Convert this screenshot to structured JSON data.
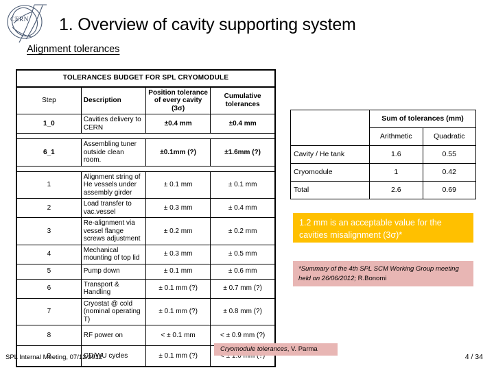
{
  "slide": {
    "title": "1. Overview of cavity supporting system",
    "subtitle": "Alignment tolerances",
    "logo_text": "CERN"
  },
  "main_table": {
    "title": "TOLERANCES BUDGET FOR SPL CRYOMODULE",
    "headers": {
      "step": "Step",
      "description": "Description",
      "position_tolerance": "Position tolerance of every cavity (3σ)",
      "cumulative": "Cumulative tolerances"
    },
    "rows": [
      {
        "step": "1_0",
        "description": "Cavities delivery to CERN",
        "position": "±0.4 mm",
        "cumulative": "±0.4 mm",
        "bold": true
      },
      {
        "step": "6_1",
        "description": "Assembling tuner outside clean room.",
        "position": "±0.1mm (?)",
        "cumulative": "±1.6mm (?)",
        "bold": true
      },
      {
        "step": "1",
        "description": "Alignment string of He vessels under assembly girder",
        "position": "± 0.1 mm",
        "cumulative": "± 0.1 mm",
        "bold": false
      },
      {
        "step": "2",
        "description": "Load transfer to vac.vessel",
        "position": "± 0.3 mm",
        "cumulative": "± 0.4 mm",
        "bold": false
      },
      {
        "step": "3",
        "description": "Re-alignment via vessel flange screws adjustment",
        "position": "± 0.2 mm",
        "cumulative": "± 0.2 mm",
        "bold": false
      },
      {
        "step": "4",
        "description": "Mechanical mounting of top lid",
        "position": "± 0.3 mm",
        "cumulative": "± 0.5 mm",
        "bold": false
      },
      {
        "step": "5",
        "description": "Pump down",
        "position": "± 0.1 mm",
        "cumulative": "± 0.6 mm",
        "bold": false
      },
      {
        "step": "6",
        "description": "Transport & Handling",
        "position": "± 0.1 mm (?)",
        "cumulative": "± 0.7 mm (?)",
        "bold": false
      },
      {
        "step": "7",
        "description": "Cryostat @ cold (nominal operating T)",
        "position": "± 0.1 mm (?)",
        "cumulative": "± 0.8 mm (?)",
        "bold": false
      },
      {
        "step": "8",
        "description": "RF power on",
        "position": "< ± 0.1 mm",
        "cumulative": "< ± 0.9 mm (?)",
        "bold": false
      },
      {
        "step": "9",
        "description": "CD/WU cycles",
        "position": "± 0.1 mm (?)",
        "cumulative": "< ± 1.0 mm (?)",
        "bold": false
      }
    ]
  },
  "summary_table": {
    "group_header": "Sum of tolerances (mm)",
    "col_headers": [
      "Arithmetic",
      "Quadratic"
    ],
    "rows": [
      {
        "label": "Cavity / He tank",
        "arithmetic": "1.6",
        "quadratic": "0.55"
      },
      {
        "label": "Cryomodule",
        "arithmetic": "1",
        "quadratic": "0.42"
      },
      {
        "label": "Total",
        "arithmetic": "2.6",
        "quadratic": "0.69"
      }
    ]
  },
  "callout": {
    "line1": "1.2 mm is an acceptable value for the",
    "line2": "cavities misalignment (3σ)*",
    "background_color": "#FFC000",
    "text_color": "#FFFFFF"
  },
  "footnote": {
    "italic_part": "*Summary of the 4th SPL SCM Working Group meeting held on 26/06/2012;",
    "plain_part": " R.Bonomi",
    "background_color": "#E8B6B4"
  },
  "banner": {
    "italic_part": "Cryomodule tolerances",
    "plain_part": ", V. Parma",
    "background_color": "#E8B6B4"
  },
  "footer": {
    "left": "SPL Internal Meeting, 07/12/2012",
    "right": "4 / 34"
  },
  "chart_data": {
    "type": "table",
    "title": "TOLERANCES BUDGET FOR SPL CRYOMODULE",
    "columns": [
      "Step",
      "Description",
      "Position tolerance of every cavity (3σ)",
      "Cumulative tolerances"
    ],
    "rows": [
      [
        "1_0",
        "Cavities delivery to CERN",
        "±0.4 mm",
        "±0.4 mm"
      ],
      [
        "6_1",
        "Assembling tuner outside clean room.",
        "±0.1mm (?)",
        "±1.6mm (?)"
      ],
      [
        "1",
        "Alignment string of He vessels under assembly girder",
        "± 0.1 mm",
        "± 0.1 mm"
      ],
      [
        "2",
        "Load transfer to vac.vessel",
        "± 0.3 mm",
        "± 0.4 mm"
      ],
      [
        "3",
        "Re-alignment via vessel flange screws adjustment",
        "± 0.2 mm",
        "± 0.2 mm"
      ],
      [
        "4",
        "Mechanical mounting of top lid",
        "± 0.3 mm",
        "± 0.5 mm"
      ],
      [
        "5",
        "Pump down",
        "± 0.1 mm",
        "± 0.6 mm"
      ],
      [
        "6",
        "Transport & Handling",
        "± 0.1 mm (?)",
        "± 0.7 mm (?)"
      ],
      [
        "7",
        "Cryostat @ cold (nominal operating T)",
        "± 0.1 mm (?)",
        "± 0.8 mm (?)"
      ],
      [
        "8",
        "RF power on",
        "< ± 0.1 mm",
        "< ± 0.9 mm (?)"
      ],
      [
        "9",
        "CD/WU cycles",
        "± 0.1 mm (?)",
        "< ± 1.0 mm (?)"
      ]
    ],
    "secondary_table": {
      "title": "Sum of tolerances (mm)",
      "columns": [
        "",
        "Arithmetic",
        "Quadratic"
      ],
      "rows": [
        [
          "Cavity / He tank",
          1.6,
          0.55
        ],
        [
          "Cryomodule",
          1,
          0.42
        ],
        [
          "Total",
          2.6,
          0.69
        ]
      ]
    }
  }
}
